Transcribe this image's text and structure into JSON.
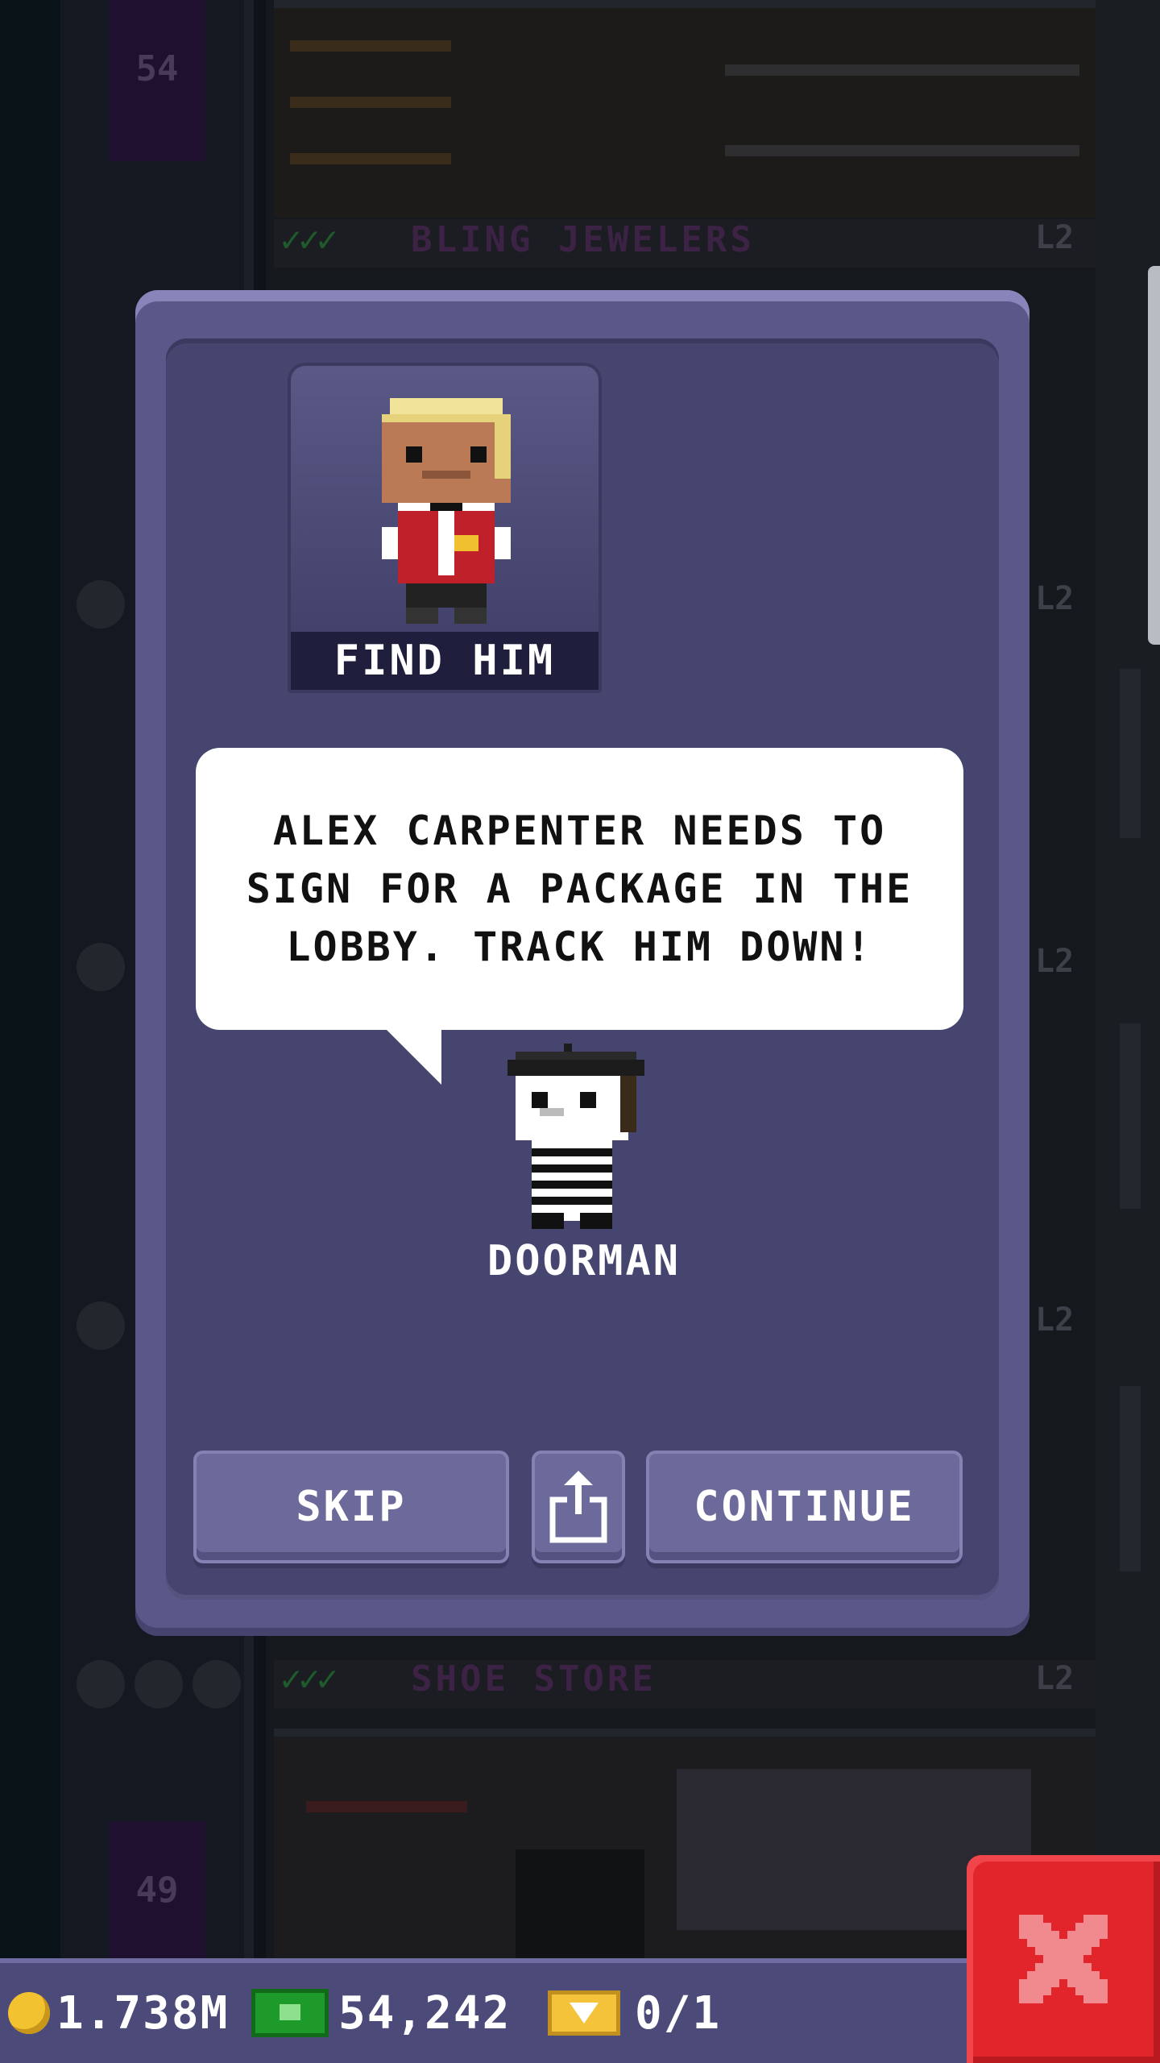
{
  "background": {
    "floor_numbers": [
      "54",
      "49"
    ],
    "stores": [
      {
        "checks": "✓✓✓",
        "name": "BLING JEWELERS",
        "level": "L2"
      },
      {
        "checks": "✓✓✓",
        "name": "SHOE STORE",
        "level": "L2"
      }
    ],
    "side_levels": [
      "L2",
      "L2",
      "L2"
    ]
  },
  "modal": {
    "portrait_label": "FIND HIM",
    "message": "ALEX CARPENTER NEEDS TO SIGN FOR A PACKAGE IN THE LOBBY. TRACK HIM DOWN!",
    "speaker": "DOORMAN",
    "buttons": {
      "skip": "SKIP",
      "share_icon": "share-icon",
      "continue": "CONTINUE"
    }
  },
  "hud": {
    "coins": "1.738M",
    "bux": "54,242",
    "tickets": "0/1",
    "close_icon": "close-icon"
  },
  "colors": {
    "modal_frame": "#5a5888",
    "modal_body": "#46456f",
    "bubble": "#ffffff",
    "close_button": "#e2242b",
    "hud_bar": "#4b4a78"
  }
}
